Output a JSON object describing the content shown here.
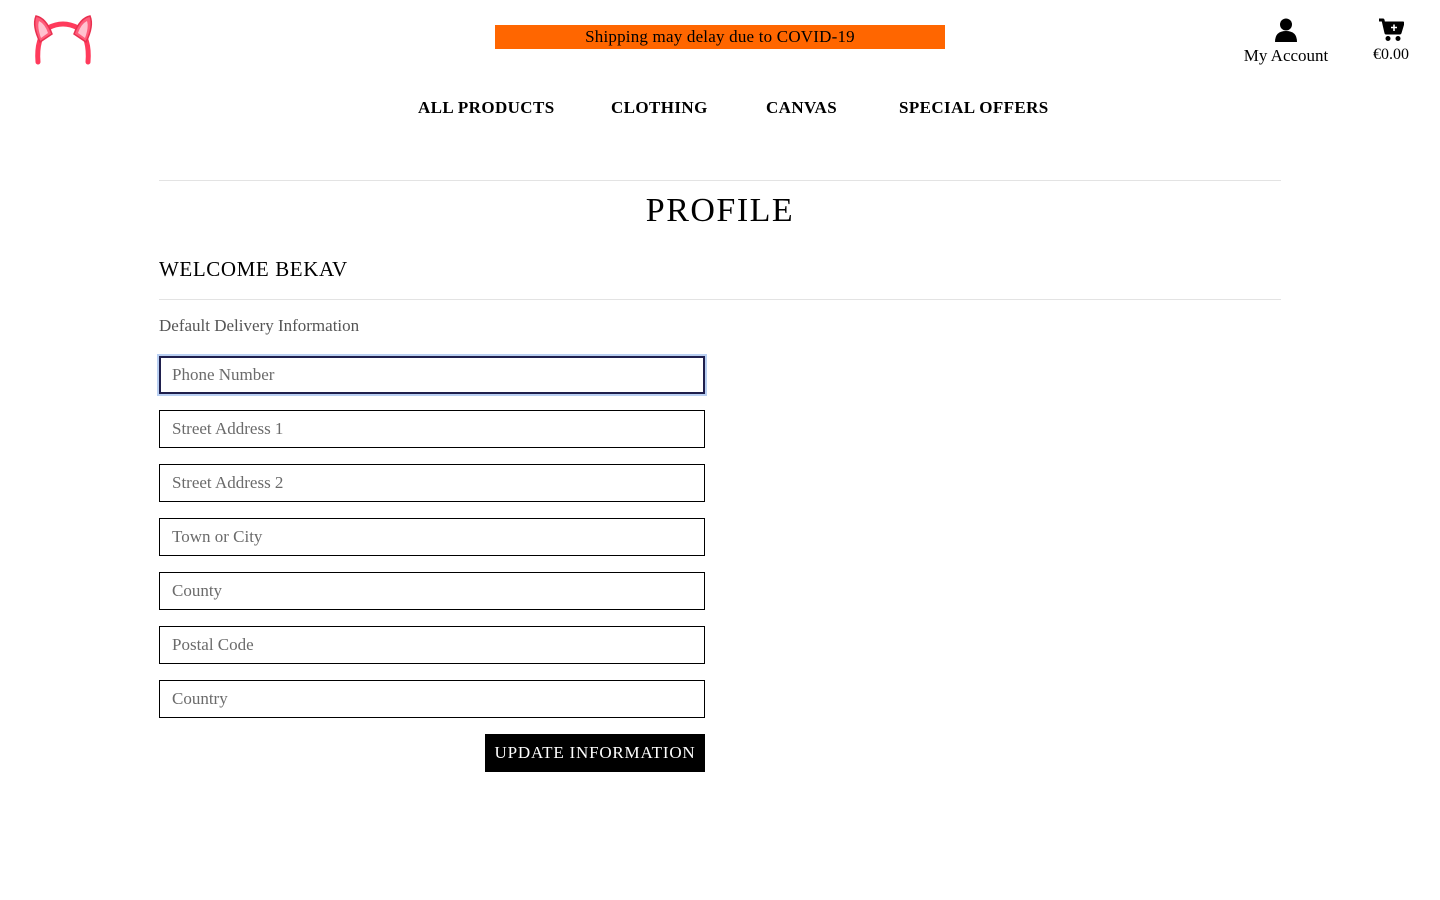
{
  "brand": {
    "logo_icon": "bunny-ears-headband-icon",
    "accent_color": "#ff3b5c"
  },
  "banner": {
    "text": "Shipping may delay due to COVID-19",
    "color": "#ff6600"
  },
  "header": {
    "account_label": "My Account",
    "account_icon": "user-icon",
    "cart_total": "€0.00",
    "cart_icon": "shopping-cart-icon"
  },
  "nav": {
    "items": [
      "ALL PRODUCTS",
      "CLOTHING",
      "CANVAS",
      "SPECIAL OFFERS"
    ]
  },
  "page": {
    "title": "PROFILE",
    "welcome": "WELCOME BEKAV",
    "section_label": "Default Delivery Information"
  },
  "form": {
    "phone": {
      "placeholder": "Phone Number",
      "value": ""
    },
    "street1": {
      "placeholder": "Street Address 1",
      "value": ""
    },
    "street2": {
      "placeholder": "Street Address 2",
      "value": ""
    },
    "town": {
      "placeholder": "Town or City",
      "value": ""
    },
    "county": {
      "placeholder": "County",
      "value": ""
    },
    "postcode": {
      "placeholder": "Postal Code",
      "value": ""
    },
    "country": {
      "placeholder": "Country",
      "value": ""
    },
    "submit_label": "UPDATE INFORMATION"
  }
}
